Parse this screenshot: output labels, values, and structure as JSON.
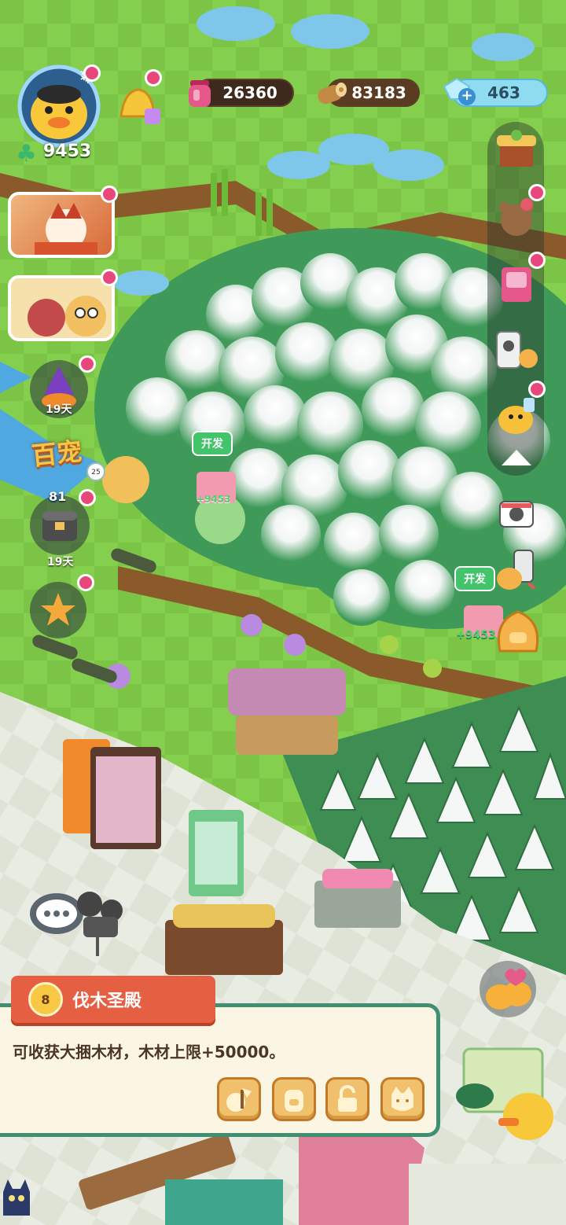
{
  "resources": {
    "potion": {
      "value": "26360",
      "icon": "pink-potion-icon"
    },
    "wood": {
      "value": "83183",
      "icon": "wood-log-icon"
    },
    "gem": {
      "value": "463",
      "icon": "ice-gem-icon",
      "add_symbol": "+"
    }
  },
  "player": {
    "level_value": "9453",
    "avatar_icon": "yellow-chick-avatar"
  },
  "side_left": {
    "event_badge_days": "19天",
    "event_logo_text": "百宠",
    "chest_count": "81",
    "chest_days": "19天",
    "small_badge_value": "25"
  },
  "map_tags": {
    "develop_label_1": "开发",
    "develop_label_2": "开发",
    "floating_value_1": "+9453",
    "floating_value_2": "+9453"
  },
  "panel": {
    "level_badge": "8",
    "building_name": "伐木圣殿",
    "description": "可收获大捆木材，木材上限+50000。",
    "buttons": [
      {
        "name": "collect-wood-button",
        "icon": "axe-chick-icon"
      },
      {
        "name": "backpack-button",
        "icon": "backpack-icon"
      },
      {
        "name": "unlock-button",
        "icon": "padlock-open-icon"
      },
      {
        "name": "cat-button",
        "icon": "cat-face-icon"
      }
    ]
  },
  "colors": {
    "grass": "#7cc84a",
    "dirt": "#8b5a2b",
    "panel_bg": "#fbf5e3",
    "panel_border": "#3f8f73",
    "ribbon": "#e55f43",
    "notify_dot": "#e7477a"
  }
}
